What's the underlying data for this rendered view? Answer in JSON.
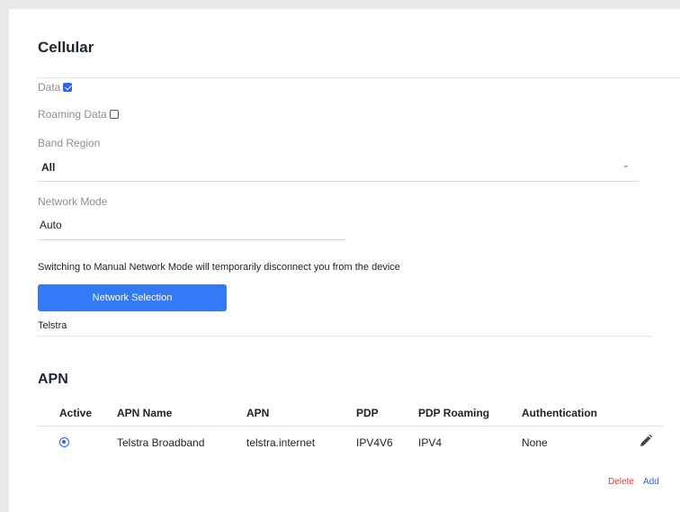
{
  "page": {
    "title": "Cellular"
  },
  "data_toggle": {
    "label": "Data",
    "checked": true
  },
  "roaming_toggle": {
    "label": "Roaming Data",
    "checked": false
  },
  "band_region": {
    "label": "Band Region",
    "value": "All"
  },
  "network_mode": {
    "label": "Network Mode",
    "value": "Auto"
  },
  "notice": "Switching to Manual Network Mode will temporarily disconnect you from the device",
  "network_selection": {
    "label": "Network Selection",
    "operator": "Telstra"
  },
  "apn": {
    "heading": "APN",
    "columns": [
      "Active",
      "APN Name",
      "APN",
      "PDP",
      "PDP Roaming",
      "Authentication"
    ],
    "rows": [
      {
        "active": true,
        "name": "Telstra Broadband",
        "apn": "telstra.internet",
        "pdp": "IPV4V6",
        "pdp_roaming": "IPV4",
        "authentication": "None"
      }
    ],
    "delete_label": "Delete",
    "add_label": "Add"
  },
  "colors": {
    "accent": "#3479f6",
    "danger": "#e53935",
    "link": "#2962ff"
  }
}
